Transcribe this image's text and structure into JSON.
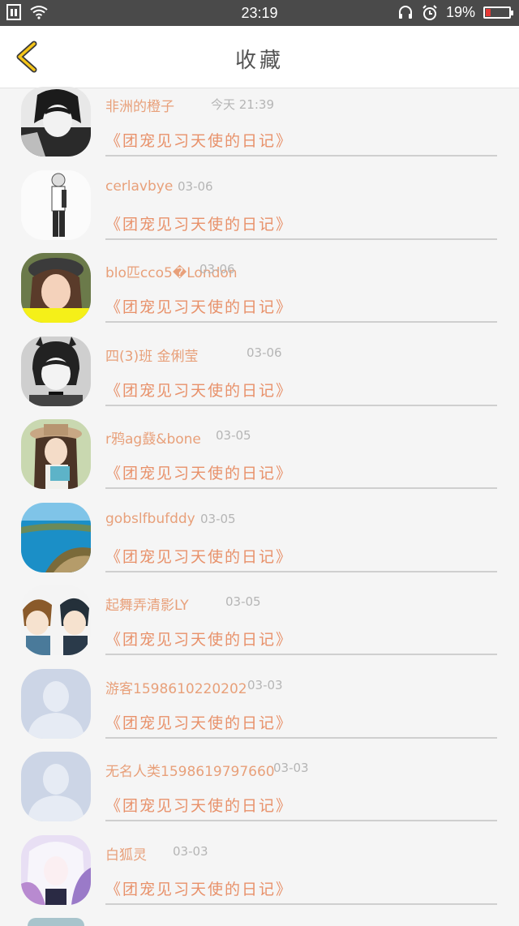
{
  "status_bar": {
    "time": "23:19",
    "battery": "19%"
  },
  "header": {
    "title": "收藏"
  },
  "favorites": [
    {
      "name": "非洲的橙子",
      "date": "今天 21:39",
      "diary": "《团宠见习天使的日记》"
    },
    {
      "name": "cerlavbye",
      "date": "03-06",
      "diary": "《团宠见习天使的日记》"
    },
    {
      "name": "blo匹cco5�London",
      "date": "03-06",
      "diary": "《团宠见习天使的日记》"
    },
    {
      "name": "四(3)班 金俐莹",
      "date": "03-06",
      "diary": "《团宠见习天使的日记》"
    },
    {
      "name": "r鸦ag鼗&bone",
      "date": "03-05",
      "diary": "《团宠见习天使的日记》"
    },
    {
      "name": "gobslfbufddy",
      "date": "03-05",
      "diary": "《团宠见习天使的日记》"
    },
    {
      "name": "起舞弄清影LY",
      "date": "03-05",
      "diary": "《团宠见习天使的日记》"
    },
    {
      "name": "游客1598610220202",
      "date": "03-03",
      "diary": "《团宠见习天使的日记》"
    },
    {
      "name": "无名人类1598619797660",
      "date": "03-03",
      "diary": "《团宠见习天使的日记》"
    },
    {
      "name": "白狐灵",
      "date": "03-03",
      "diary": "《团宠见习天使的日记》"
    }
  ]
}
